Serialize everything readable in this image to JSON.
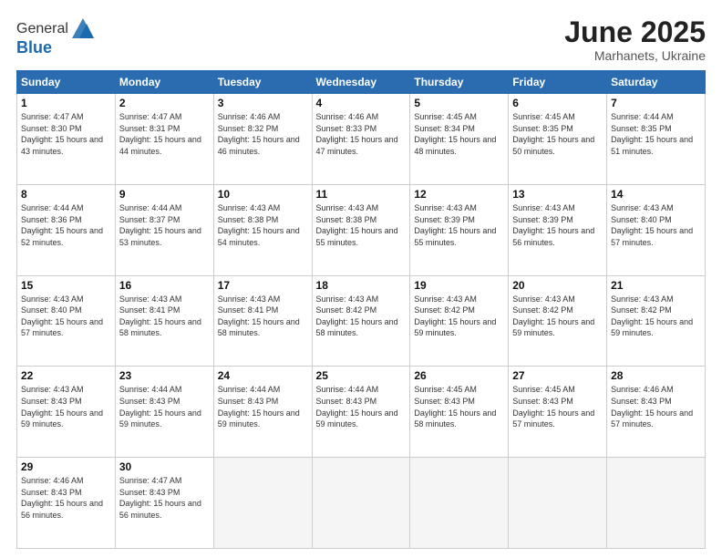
{
  "header": {
    "logo_general": "General",
    "logo_blue": "Blue",
    "month_title": "June 2025",
    "location": "Marhanets, Ukraine"
  },
  "weekdays": [
    "Sunday",
    "Monday",
    "Tuesday",
    "Wednesday",
    "Thursday",
    "Friday",
    "Saturday"
  ],
  "weeks": [
    [
      {
        "day": "1",
        "sunrise": "4:47 AM",
        "sunset": "8:30 PM",
        "daylight": "15 hours and 43 minutes."
      },
      {
        "day": "2",
        "sunrise": "4:47 AM",
        "sunset": "8:31 PM",
        "daylight": "15 hours and 44 minutes."
      },
      {
        "day": "3",
        "sunrise": "4:46 AM",
        "sunset": "8:32 PM",
        "daylight": "15 hours and 46 minutes."
      },
      {
        "day": "4",
        "sunrise": "4:46 AM",
        "sunset": "8:33 PM",
        "daylight": "15 hours and 47 minutes."
      },
      {
        "day": "5",
        "sunrise": "4:45 AM",
        "sunset": "8:34 PM",
        "daylight": "15 hours and 48 minutes."
      },
      {
        "day": "6",
        "sunrise": "4:45 AM",
        "sunset": "8:35 PM",
        "daylight": "15 hours and 50 minutes."
      },
      {
        "day": "7",
        "sunrise": "4:44 AM",
        "sunset": "8:35 PM",
        "daylight": "15 hours and 51 minutes."
      }
    ],
    [
      {
        "day": "8",
        "sunrise": "4:44 AM",
        "sunset": "8:36 PM",
        "daylight": "15 hours and 52 minutes."
      },
      {
        "day": "9",
        "sunrise": "4:44 AM",
        "sunset": "8:37 PM",
        "daylight": "15 hours and 53 minutes."
      },
      {
        "day": "10",
        "sunrise": "4:43 AM",
        "sunset": "8:38 PM",
        "daylight": "15 hours and 54 minutes."
      },
      {
        "day": "11",
        "sunrise": "4:43 AM",
        "sunset": "8:38 PM",
        "daylight": "15 hours and 55 minutes."
      },
      {
        "day": "12",
        "sunrise": "4:43 AM",
        "sunset": "8:39 PM",
        "daylight": "15 hours and 55 minutes."
      },
      {
        "day": "13",
        "sunrise": "4:43 AM",
        "sunset": "8:39 PM",
        "daylight": "15 hours and 56 minutes."
      },
      {
        "day": "14",
        "sunrise": "4:43 AM",
        "sunset": "8:40 PM",
        "daylight": "15 hours and 57 minutes."
      }
    ],
    [
      {
        "day": "15",
        "sunrise": "4:43 AM",
        "sunset": "8:40 PM",
        "daylight": "15 hours and 57 minutes."
      },
      {
        "day": "16",
        "sunrise": "4:43 AM",
        "sunset": "8:41 PM",
        "daylight": "15 hours and 58 minutes."
      },
      {
        "day": "17",
        "sunrise": "4:43 AM",
        "sunset": "8:41 PM",
        "daylight": "15 hours and 58 minutes."
      },
      {
        "day": "18",
        "sunrise": "4:43 AM",
        "sunset": "8:42 PM",
        "daylight": "15 hours and 58 minutes."
      },
      {
        "day": "19",
        "sunrise": "4:43 AM",
        "sunset": "8:42 PM",
        "daylight": "15 hours and 59 minutes."
      },
      {
        "day": "20",
        "sunrise": "4:43 AM",
        "sunset": "8:42 PM",
        "daylight": "15 hours and 59 minutes."
      },
      {
        "day": "21",
        "sunrise": "4:43 AM",
        "sunset": "8:42 PM",
        "daylight": "15 hours and 59 minutes."
      }
    ],
    [
      {
        "day": "22",
        "sunrise": "4:43 AM",
        "sunset": "8:43 PM",
        "daylight": "15 hours and 59 minutes."
      },
      {
        "day": "23",
        "sunrise": "4:44 AM",
        "sunset": "8:43 PM",
        "daylight": "15 hours and 59 minutes."
      },
      {
        "day": "24",
        "sunrise": "4:44 AM",
        "sunset": "8:43 PM",
        "daylight": "15 hours and 59 minutes."
      },
      {
        "day": "25",
        "sunrise": "4:44 AM",
        "sunset": "8:43 PM",
        "daylight": "15 hours and 59 minutes."
      },
      {
        "day": "26",
        "sunrise": "4:45 AM",
        "sunset": "8:43 PM",
        "daylight": "15 hours and 58 minutes."
      },
      {
        "day": "27",
        "sunrise": "4:45 AM",
        "sunset": "8:43 PM",
        "daylight": "15 hours and 57 minutes."
      },
      {
        "day": "28",
        "sunrise": "4:46 AM",
        "sunset": "8:43 PM",
        "daylight": "15 hours and 57 minutes."
      }
    ],
    [
      {
        "day": "29",
        "sunrise": "4:46 AM",
        "sunset": "8:43 PM",
        "daylight": "15 hours and 56 minutes."
      },
      {
        "day": "30",
        "sunrise": "4:47 AM",
        "sunset": "8:43 PM",
        "daylight": "15 hours and 56 minutes."
      },
      null,
      null,
      null,
      null,
      null
    ]
  ]
}
